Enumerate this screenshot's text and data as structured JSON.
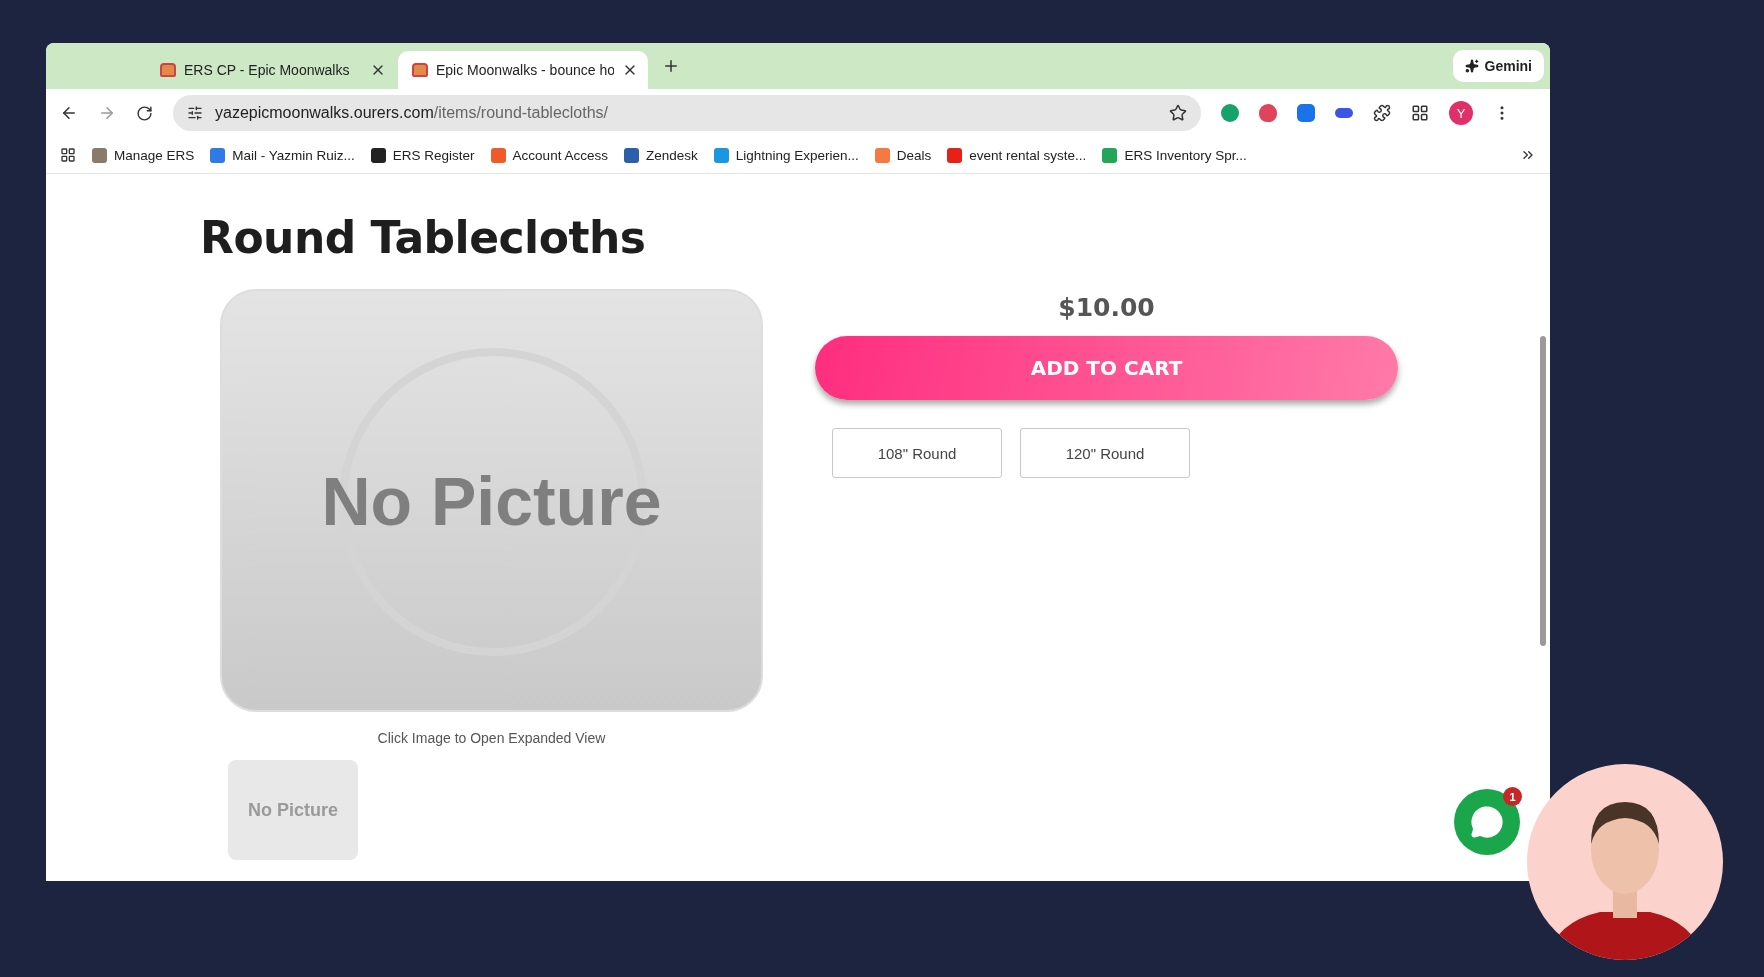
{
  "tabs": [
    {
      "title": "ERS CP - Epic Moonwalks",
      "selected": false
    },
    {
      "title": "Epic Moonwalks - bounce ho",
      "selected": true
    }
  ],
  "gemini": "Gemini",
  "address": {
    "domain": "yazepicmoonwalks.ourers.com",
    "path": "/items/round-tablecloths/"
  },
  "profile": "Y",
  "bookmarks": [
    {
      "label": "Manage ERS",
      "color": "#8a7a6a"
    },
    {
      "label": "Mail - Yazmin Ruiz...",
      "color": "#2f7be5"
    },
    {
      "label": "ERS Register",
      "color": "#222222"
    },
    {
      "label": "Account Access",
      "color": "#f05a28"
    },
    {
      "label": "Zendesk",
      "color": "#2d5fa8"
    },
    {
      "label": "Lightning Experien...",
      "color": "#1b96e0"
    },
    {
      "label": "Deals",
      "color": "#f57a42"
    },
    {
      "label": "event rental syste...",
      "color": "#e62117"
    },
    {
      "label": "ERS Inventory Spr...",
      "color": "#23a55a"
    }
  ],
  "page": {
    "title": "Round Tablecloths",
    "image_label": "No Picture",
    "caption": "Click Image to Open Expanded View",
    "thumbnails": [
      {
        "label": "No Picture"
      }
    ],
    "price": "$10.00",
    "add_to_cart": "ADD TO CART",
    "options": [
      {
        "label": "108\" Round"
      },
      {
        "label": "120\" Round"
      }
    ]
  },
  "chat": {
    "badge": "1"
  }
}
